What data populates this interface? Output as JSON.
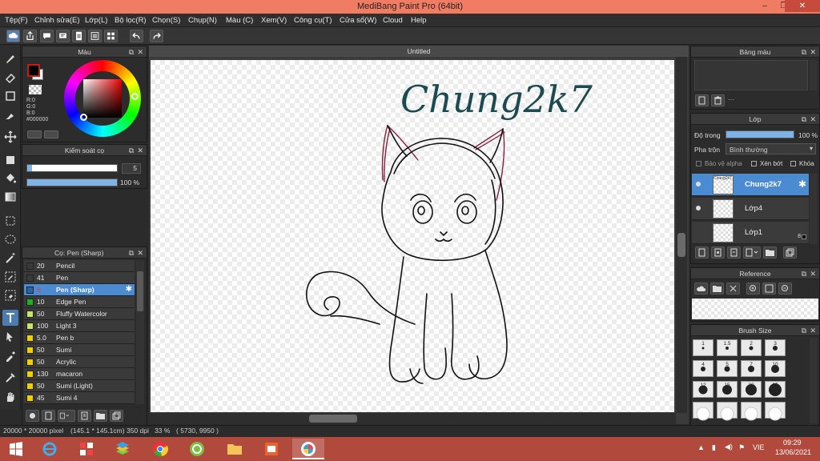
{
  "window": {
    "title": "MediBang Paint Pro (64bit)",
    "min": "–",
    "max": "❐",
    "close": "✕"
  },
  "menu": [
    "Tệp(F)",
    "Chỉnh sửa(E)",
    "Lớp(L)",
    "Bộ lọc(R)",
    "Chọn(S)",
    "Chụp(N)",
    "Màu (C)",
    "Xem(V)",
    "Công cụ(T)",
    "Cửa sổ(W)",
    "Cloud",
    "Help"
  ],
  "color_panel": {
    "title": "Màu",
    "r": "R:0",
    "g": "G:0",
    "b": "B:0",
    "hex": "#000000"
  },
  "brush_control": {
    "title": "Kiểm soát cọ",
    "size_value": "5",
    "opacity_value": "100 %",
    "size_fraction": 0.05,
    "opacity_fraction": 1.0
  },
  "brush_list": {
    "title": "Cọ: Pen (Sharp)",
    "items": [
      {
        "size": "20",
        "name": "Pencil",
        "color": "#3a3a3a"
      },
      {
        "size": "41",
        "name": "Pen",
        "color": "#3a3a3a"
      },
      {
        "size": "5",
        "name": "Pen (Sharp)",
        "color": "#2b63a6",
        "selected": true
      },
      {
        "size": "10",
        "name": "Edge Pen",
        "color": "#20b020"
      },
      {
        "size": "50",
        "name": "Fluffy Watercolor",
        "color": "#c8e860"
      },
      {
        "size": "100",
        "name": "Light 3",
        "color": "#c8e860"
      },
      {
        "size": "5.0",
        "name": " Pen b",
        "color": "#f2d000"
      },
      {
        "size": "50",
        "name": "Sumi",
        "color": "#f2d000"
      },
      {
        "size": "50",
        "name": "Acrylic",
        "color": "#f2d000"
      },
      {
        "size": "130",
        "name": "macaron",
        "color": "#f2d000"
      },
      {
        "size": "50",
        "name": "Sumi (Light)",
        "color": "#f2d000"
      },
      {
        "size": "45",
        "name": "Sumi 4",
        "color": "#f2d000"
      }
    ]
  },
  "canvas": {
    "tab": "Untitled",
    "text": "Chung2k7"
  },
  "status": {
    "size": "20000 * 20000 pixel",
    "physical": "(145.1 * 145.1cm)",
    "dpi": "350 dpi",
    "zoom": "33 %",
    "coords": "( 5730, 9950 )"
  },
  "palette_panel": {
    "title": "Bảng màu",
    "extra": "···"
  },
  "layer_panel": {
    "title": "Lớp",
    "opacity_label": "Độ trong",
    "opacity_value": "100 %",
    "opacity_fraction": 1.0,
    "blend_label": "Pha trộn",
    "blend_value": "Bình thường",
    "protect_alpha": "Bảo vệ alpha",
    "clipping": "Xén bớt",
    "lock": "Khóa",
    "layers": [
      {
        "name": "Chung2k7",
        "thumb_text": "Chung2k7",
        "selected": true
      },
      {
        "name": "Lớp4"
      },
      {
        "name": "Lớp1",
        "badge": "8"
      }
    ]
  },
  "reference_panel": {
    "title": "Reference"
  },
  "brush_size_panel": {
    "title": "Brush Size",
    "sizes": [
      "1",
      "1.5",
      "2",
      "3",
      "4",
      "5",
      "7",
      "10",
      "12",
      "15",
      "20",
      "25",
      "",
      "",
      "",
      ""
    ]
  },
  "taskbar": {
    "lang": "VIE",
    "time": "09:29",
    "date": "13/06/2021"
  }
}
